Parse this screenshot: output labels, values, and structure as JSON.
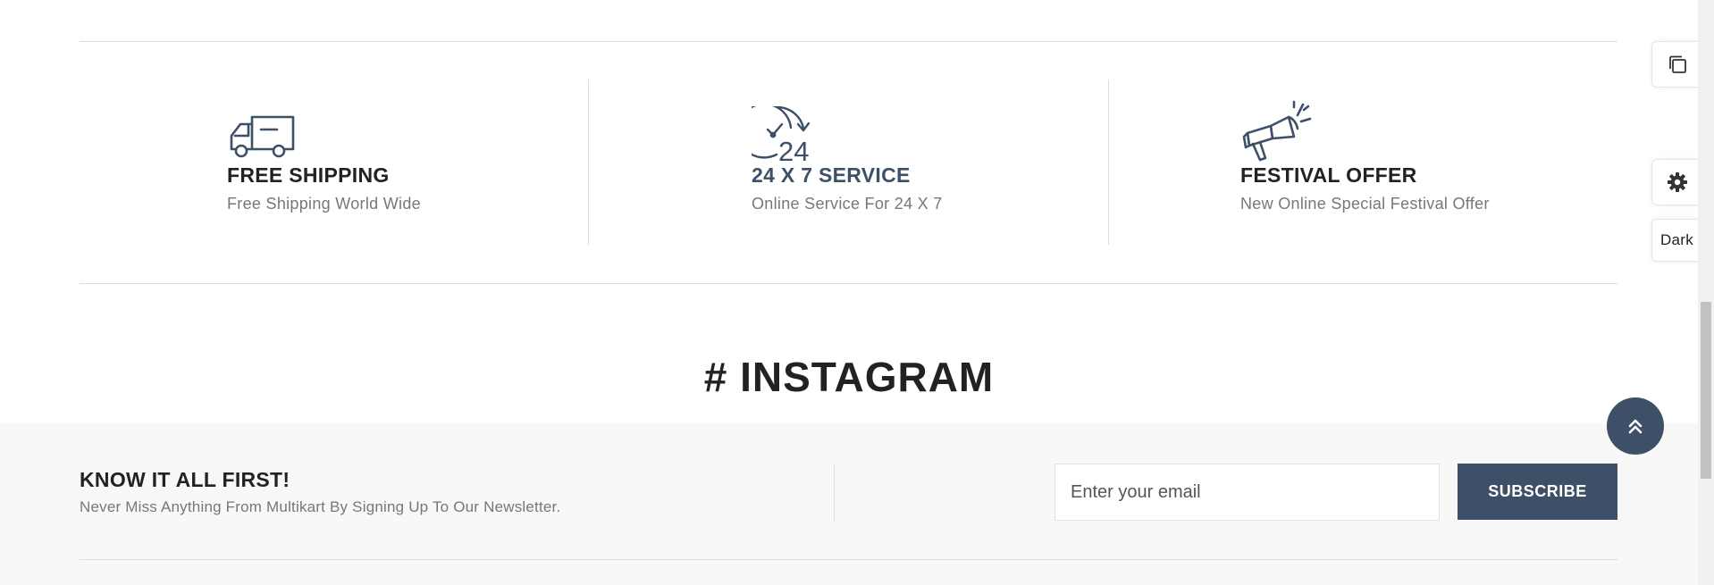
{
  "services": [
    {
      "title": "FREE SHIPPING",
      "description": "Free Shipping World Wide",
      "icon": "truck-icon"
    },
    {
      "title": "24 X 7 SERVICE",
      "description": "Online Service For 24 X 7",
      "icon": "clock-24-icon",
      "icon_text": "24"
    },
    {
      "title": "FESTIVAL OFFER",
      "description": "New Online Special Festival Offer",
      "icon": "megaphone-icon"
    }
  ],
  "instagram": {
    "title": "# INSTAGRAM"
  },
  "newsletter": {
    "title": "KNOW IT ALL FIRST!",
    "subtitle": "Never Miss Anything From Multikart By Signing Up To Our Newsletter.",
    "email_placeholder": "Enter your email",
    "subscribe_label": "SUBSCRIBE"
  },
  "side_panel": {
    "copy_icon": "copy-icon",
    "settings_icon": "gear-icon",
    "dark_label": "Dark"
  },
  "back_to_top": {
    "icon": "double-chevron-up-icon"
  },
  "colors": {
    "accent": "#3e5067",
    "icon_stroke": "#3e5067",
    "text_primary": "#222222",
    "text_muted": "#777777",
    "newsletter_bg": "#f8f8f8"
  }
}
